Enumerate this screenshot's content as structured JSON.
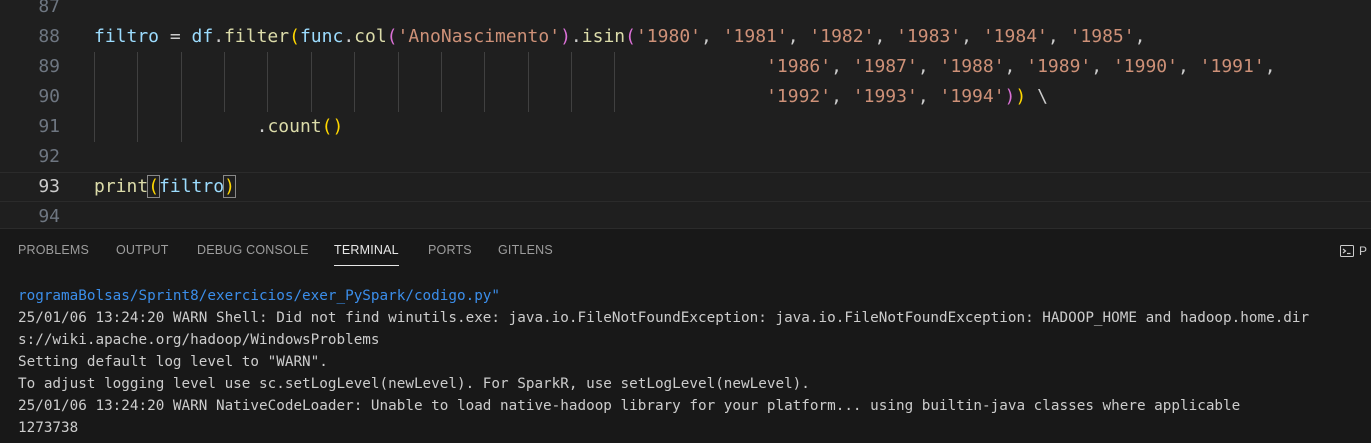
{
  "editor": {
    "lines": [
      {
        "num": "87"
      },
      {
        "num": "88",
        "tokens": [
          {
            "t": "filtro",
            "c": "v"
          },
          {
            "t": " = ",
            "c": "p"
          },
          {
            "t": "df",
            "c": "v"
          },
          {
            "t": ".",
            "c": "p"
          },
          {
            "t": "filter",
            "c": "f"
          },
          {
            "t": "(",
            "c": "b1"
          },
          {
            "t": "func",
            "c": "v"
          },
          {
            "t": ".",
            "c": "p"
          },
          {
            "t": "col",
            "c": "f"
          },
          {
            "t": "(",
            "c": "b2"
          },
          {
            "t": "'AnoNascimento'",
            "c": "s"
          },
          {
            "t": ")",
            "c": "b2"
          },
          {
            "t": ".",
            "c": "p"
          },
          {
            "t": "isin",
            "c": "f"
          },
          {
            "t": "(",
            "c": "b2"
          },
          {
            "t": "'1980'",
            "c": "s"
          },
          {
            "t": ", ",
            "c": "p"
          },
          {
            "t": "'1981'",
            "c": "s"
          },
          {
            "t": ", ",
            "c": "p"
          },
          {
            "t": "'1982'",
            "c": "s"
          },
          {
            "t": ", ",
            "c": "p"
          },
          {
            "t": "'1983'",
            "c": "s"
          },
          {
            "t": ", ",
            "c": "p"
          },
          {
            "t": "'1984'",
            "c": "s"
          },
          {
            "t": ", ",
            "c": "p"
          },
          {
            "t": "'1985'",
            "c": "s"
          },
          {
            "t": ",",
            "c": "p"
          }
        ]
      },
      {
        "num": "89",
        "indent": 62,
        "tokens": [
          {
            "t": "'1986'",
            "c": "s"
          },
          {
            "t": ", ",
            "c": "p"
          },
          {
            "t": "'1987'",
            "c": "s"
          },
          {
            "t": ", ",
            "c": "p"
          },
          {
            "t": "'1988'",
            "c": "s"
          },
          {
            "t": ", ",
            "c": "p"
          },
          {
            "t": "'1989'",
            "c": "s"
          },
          {
            "t": ", ",
            "c": "p"
          },
          {
            "t": "'1990'",
            "c": "s"
          },
          {
            "t": ", ",
            "c": "p"
          },
          {
            "t": "'1991'",
            "c": "s"
          },
          {
            "t": ",",
            "c": "p"
          }
        ]
      },
      {
        "num": "90",
        "indent": 62,
        "tokens": [
          {
            "t": "'1992'",
            "c": "s"
          },
          {
            "t": ", ",
            "c": "p"
          },
          {
            "t": "'1993'",
            "c": "s"
          },
          {
            "t": ", ",
            "c": "p"
          },
          {
            "t": "'1994'",
            "c": "s"
          },
          {
            "t": ")",
            "c": "b2"
          },
          {
            "t": ")",
            "c": "b1"
          },
          {
            "t": " \\",
            "c": "p"
          }
        ]
      },
      {
        "num": "91",
        "indent": 15,
        "tokens": [
          {
            "t": ".",
            "c": "p"
          },
          {
            "t": "count",
            "c": "f"
          },
          {
            "t": "(",
            "c": "b1"
          },
          {
            "t": ")",
            "c": "b1"
          }
        ]
      },
      {
        "num": "92"
      },
      {
        "num": "93",
        "current": true,
        "tokens": [
          {
            "t": "print",
            "c": "f"
          },
          {
            "t": "(",
            "c": "b1 cursor-br"
          },
          {
            "t": "filtro",
            "c": "v"
          },
          {
            "t": ")",
            "c": "b1 cursor-br"
          }
        ]
      },
      {
        "num": "94"
      }
    ]
  },
  "panel": {
    "tabs": [
      {
        "label": "PROBLEMS"
      },
      {
        "label": "OUTPUT"
      },
      {
        "label": "DEBUG CONSOLE"
      },
      {
        "label": "TERMINAL",
        "active": true
      },
      {
        "label": "PORTS"
      },
      {
        "label": "GITLENS"
      }
    ],
    "terminal_icon": "terminal-icon",
    "terminal_label": "P",
    "terminal_lines": [
      {
        "text": "rogramaBolsas/Sprint8/exercicios/exer_PySpark/codigo.py\"",
        "link": true
      },
      {
        "text": "25/01/06 13:24:20 WARN Shell: Did not find winutils.exe: java.io.FileNotFoundException: java.io.FileNotFoundException: HADOOP_HOME and hadoop.home.dir"
      },
      {
        "text": "s://wiki.apache.org/hadoop/WindowsProblems"
      },
      {
        "text": "Setting default log level to \"WARN\"."
      },
      {
        "text": "To adjust logging level use sc.setLogLevel(newLevel). For SparkR, use setLogLevel(newLevel)."
      },
      {
        "text": "25/01/06 13:24:20 WARN NativeCodeLoader: Unable to load native-hadoop library for your platform... using builtin-java classes where applicable"
      },
      {
        "text": "1273738"
      }
    ]
  },
  "colors": {
    "background": "#1f1f1f",
    "panel_background": "#181818",
    "string": "#ce9178",
    "variable": "#9cdcfe",
    "function": "#dcdcaa",
    "bracket_level1": "#ffd700",
    "bracket_level2": "#da70d6",
    "link": "#3b8eea"
  }
}
